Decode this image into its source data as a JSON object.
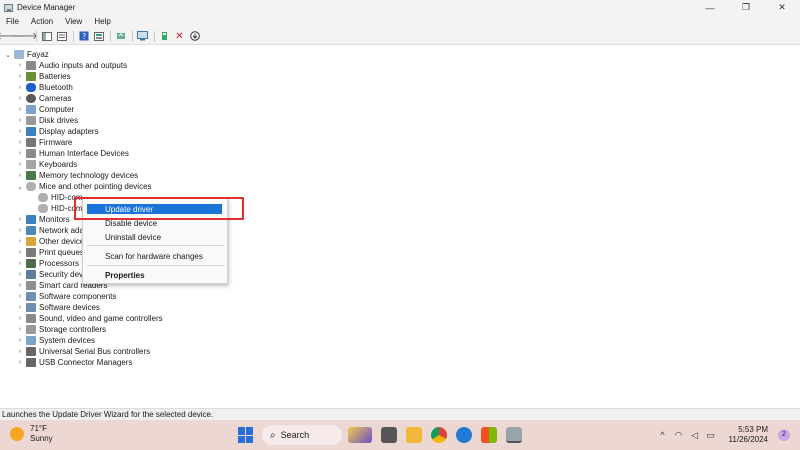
{
  "window": {
    "title": "Device Manager",
    "minimize": "—",
    "maximize": "❐",
    "close": "✕"
  },
  "menu": [
    "File",
    "Action",
    "View",
    "Help"
  ],
  "toolbar": [
    "back-arrow",
    "forward-arrow",
    "show-hide-tree",
    "properties",
    "help",
    "view-list",
    "update-driver",
    "scan-hardware",
    "enable-device",
    "uninstall-device",
    "download-driver"
  ],
  "tree": {
    "root": "Fayaz",
    "items": [
      "Audio inputs and outputs",
      "Batteries",
      "Bluetooth",
      "Cameras",
      "Computer",
      "Disk drives",
      "Display adapters",
      "Firmware",
      "Human Interface Devices",
      "Keyboards",
      "Memory technology devices",
      "Mice and other pointing devices",
      "HID-com",
      "HID-com",
      "Monitors",
      "Network ada",
      "Other device",
      "Print queues",
      "Processors",
      "Security devi",
      "Smart card readers",
      "Software components",
      "Software devices",
      "Sound, video and game controllers",
      "Storage controllers",
      "System devices",
      "Universal Serial Bus controllers",
      "USB Connector Managers"
    ]
  },
  "context_menu": {
    "update": "Update driver",
    "disable": "Disable device",
    "uninstall": "Uninstall device",
    "scan": "Scan for hardware changes",
    "properties": "Properties"
  },
  "status": "Launches the Update Driver Wizard for the selected device.",
  "taskbar": {
    "temperature": "71°F",
    "condition": "Sunny",
    "search": "Search",
    "time": "5:53 PM",
    "date": "11/26/2024",
    "notifications": "2"
  },
  "colors": {
    "accent": "#1a73d9",
    "highlight_border": "#e03030",
    "taskbar": "#ecd7d3"
  }
}
